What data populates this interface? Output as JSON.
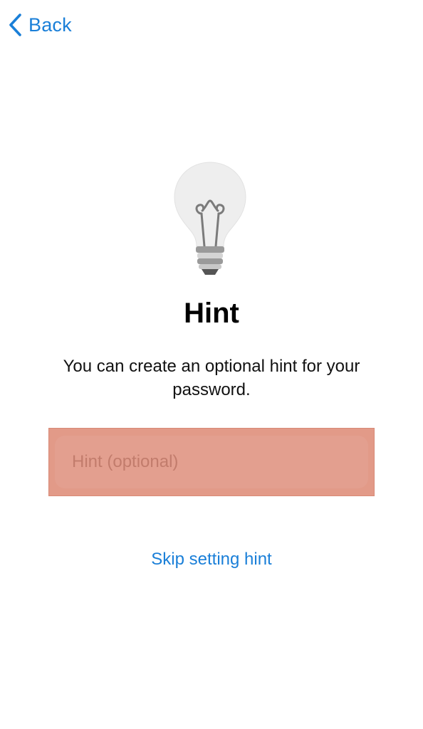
{
  "nav": {
    "back_label": "Back"
  },
  "icons": {
    "back": "chevron-left-icon",
    "illustration": "lightbulb-icon"
  },
  "header": {
    "title": "Hint",
    "description": "You can create an optional hint for your password."
  },
  "hint_input": {
    "value": "",
    "placeholder": "Hint (optional)"
  },
  "actions": {
    "skip_label": "Skip setting hint"
  },
  "colors": {
    "accent": "#1a7fd8",
    "highlight": "#e29a88",
    "background": "#ffffff"
  }
}
